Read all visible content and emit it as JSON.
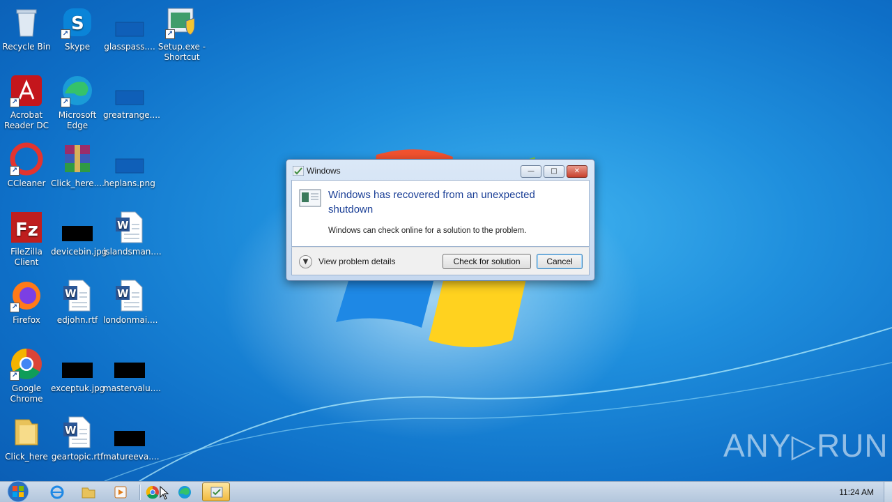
{
  "desktop": {
    "icons": [
      {
        "label": "Recycle Bin",
        "icon": "recycle-bin-icon"
      },
      {
        "label": "Skype",
        "icon": "skype-icon"
      },
      {
        "label": "glasspass....",
        "icon": "blank-file-icon"
      },
      {
        "label": "Setup.exe - Shortcut",
        "icon": "setup-shortcut-icon"
      },
      {
        "label": "Acrobat Reader DC",
        "icon": "acrobat-icon"
      },
      {
        "label": "Microsoft Edge",
        "icon": "edge-icon"
      },
      {
        "label": "greatrange....",
        "icon": "blank-file-icon"
      },
      {
        "label": "CCleaner",
        "icon": "ccleaner-icon"
      },
      {
        "label": "Click_here....",
        "icon": "winrar-icon"
      },
      {
        "label": "heplans.png",
        "icon": "blank-file-icon"
      },
      {
        "label": "FileZilla Client",
        "icon": "filezilla-icon"
      },
      {
        "label": "devicebin.jpg",
        "icon": "black-image-icon"
      },
      {
        "label": "islandsman....",
        "icon": "word-doc-icon"
      },
      {
        "label": "Firefox",
        "icon": "firefox-icon"
      },
      {
        "label": "edjohn.rtf",
        "icon": "word-doc-icon"
      },
      {
        "label": "londonmai....",
        "icon": "word-doc-icon"
      },
      {
        "label": "Google Chrome",
        "icon": "chrome-icon"
      },
      {
        "label": "exceptuk.jpg",
        "icon": "black-image-icon"
      },
      {
        "label": "mastervalu....",
        "icon": "black-image-icon"
      },
      {
        "label": "Click_here",
        "icon": "folder-icon"
      },
      {
        "label": "geartopic.rtf",
        "icon": "word-doc-icon"
      },
      {
        "label": "matureeva....",
        "icon": "black-image-icon"
      }
    ]
  },
  "dialog": {
    "title": "Windows",
    "headline": "Windows has recovered from an unexpected shutdown",
    "subtext": "Windows can check online for a solution to the problem.",
    "details_label": "View problem details",
    "check_label": "Check for solution",
    "cancel_label": "Cancel",
    "min_glyph": "—",
    "max_glyph": "□",
    "close_glyph": "✕"
  },
  "taskbar": {
    "clock": "11:24 AM",
    "items": [
      "internet-explorer-icon",
      "file-explorer-icon",
      "media-player-icon",
      "chrome-icon",
      "edge-icon",
      "problem-reporting-icon"
    ]
  },
  "watermark": "ANY▷RUN",
  "colors": {
    "accent": "#1b3f96",
    "desktop": "#1f8fdd"
  }
}
